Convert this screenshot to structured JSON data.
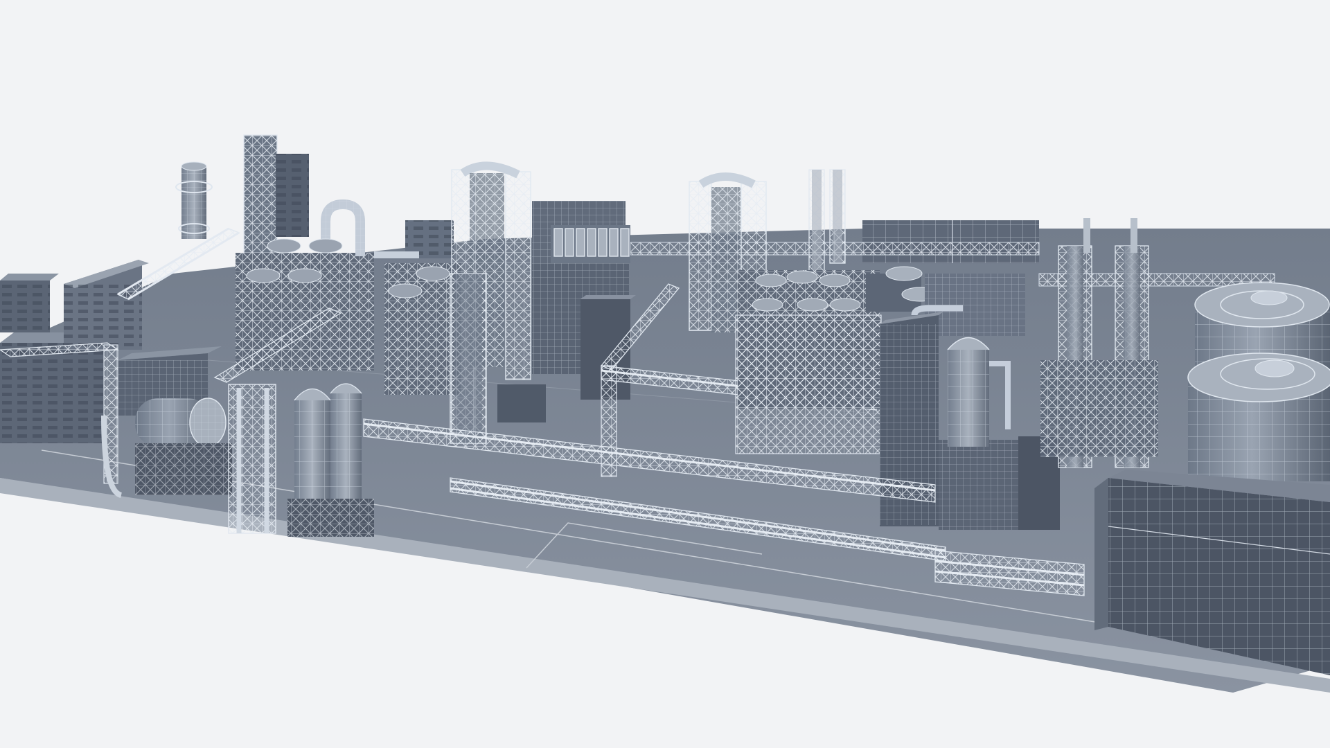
{
  "scene": {
    "subject": "wireframe-render-industrial-plant",
    "colors": {
      "background": "#f2f3f5",
      "slab_top": "#7d8796",
      "slab_front": "#a7afbb",
      "building_dark": "#586272",
      "building_mid": "#6b7585",
      "building_light": "#8a93a1",
      "wire": "#dfe6ef",
      "pipe": "#c9d2dd",
      "shadow": "#4b5462"
    }
  }
}
